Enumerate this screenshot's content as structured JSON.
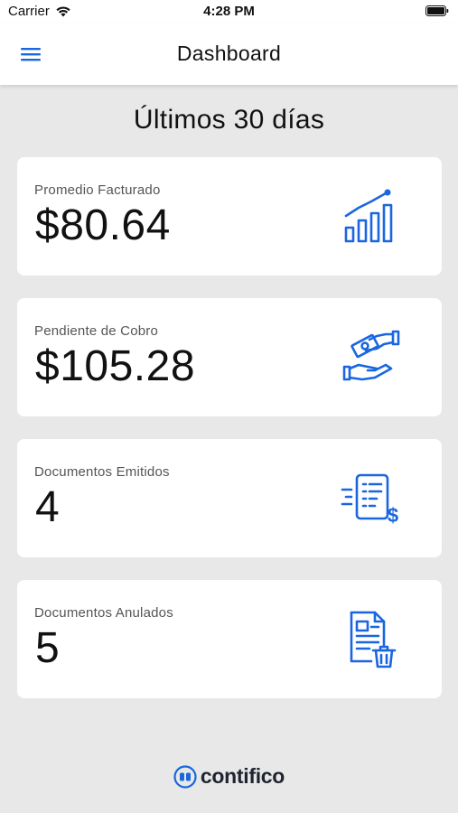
{
  "status_bar": {
    "carrier": "Carrier",
    "time": "4:28 PM"
  },
  "nav": {
    "title": "Dashboard",
    "menu_icon": "hamburger-menu-icon"
  },
  "section_title": "Últimos 30 días",
  "cards": [
    {
      "label": "Promedio Facturado",
      "value": "$80.64",
      "icon": "growth-chart-icon"
    },
    {
      "label": "Pendiente de Cobro",
      "value": "$105.28",
      "icon": "money-hand-icon"
    },
    {
      "label": "Documentos Emitidos",
      "value": "4",
      "icon": "invoice-dollar-icon"
    },
    {
      "label": "Documentos Anulados",
      "value": "5",
      "icon": "document-delete-icon"
    }
  ],
  "footer": {
    "logo_text": "contifico"
  },
  "colors": {
    "accent": "#1a66e0",
    "background": "#e8e8e8",
    "card": "#ffffff"
  }
}
